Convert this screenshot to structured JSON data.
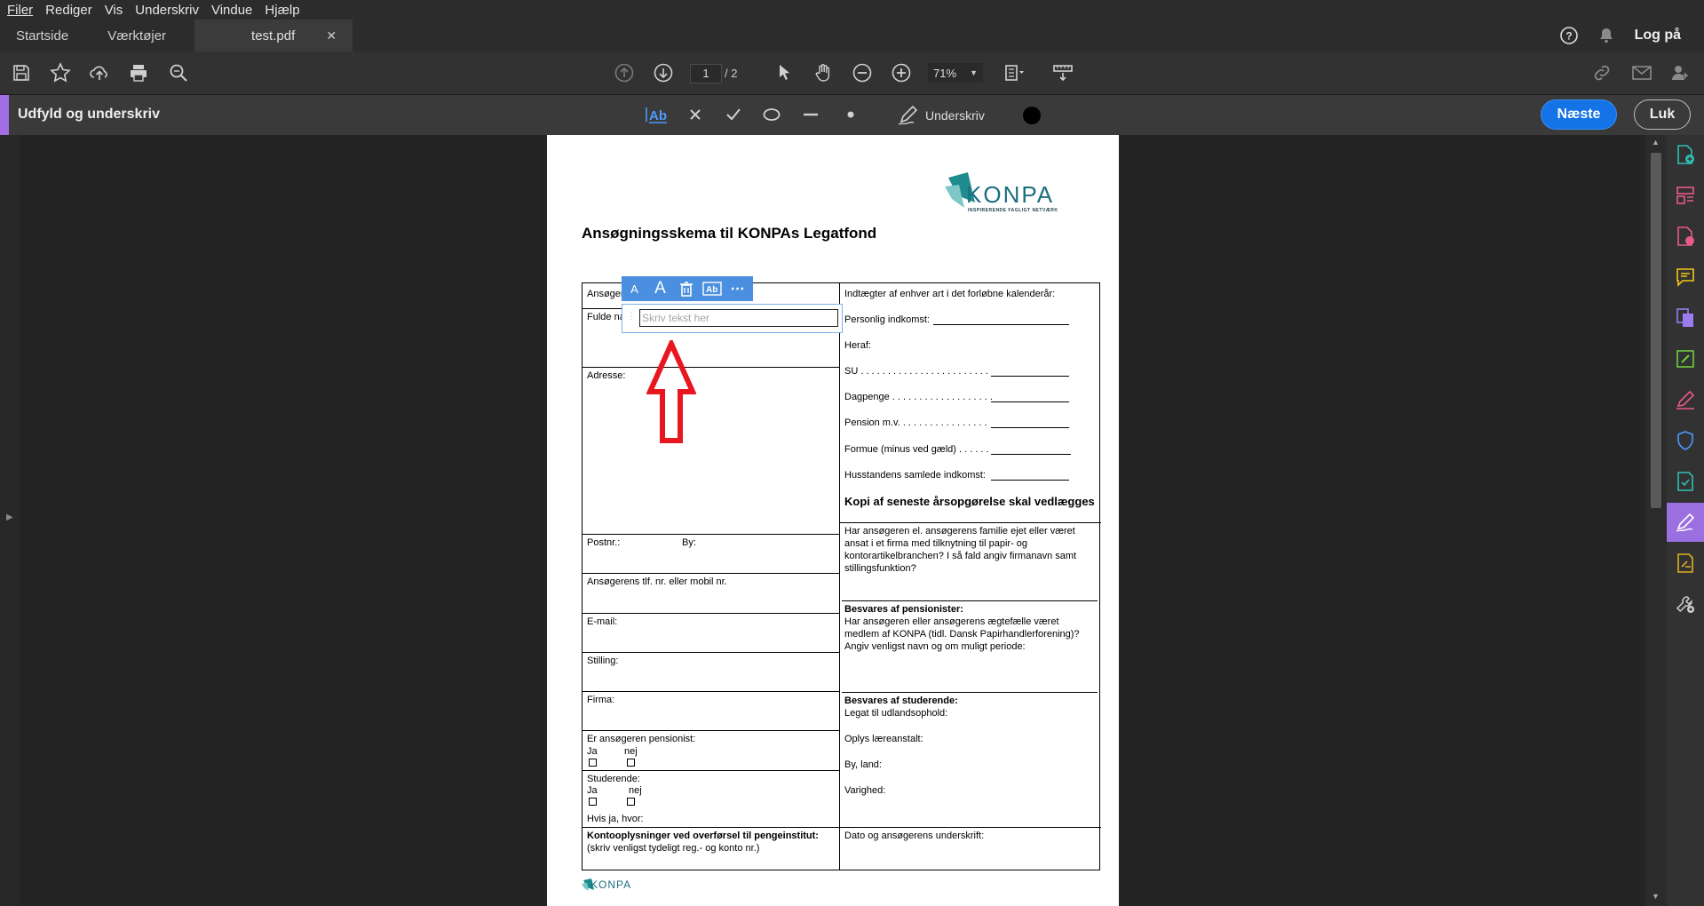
{
  "menu": [
    "Filer",
    "Rediger",
    "Vis",
    "Underskriv",
    "Vindue",
    "Hjælp"
  ],
  "tabs": {
    "home": "Startside",
    "tools": "Værktøjer",
    "document": "test.pdf"
  },
  "header": {
    "login": "Log på"
  },
  "toolbar": {
    "page_current": "1",
    "page_total": "/ 2",
    "zoom": "71%"
  },
  "fill_sign": {
    "title": "Udfyld og underskriv",
    "sign_label": "Underskriv",
    "next": "Næste",
    "close": "Luk",
    "ink_color": "#000000"
  },
  "textfield": {
    "placeholder": "Skriv tekst her"
  },
  "pdf": {
    "logo": "KONPA",
    "logo_tagline": "INSPIRERENDE FAGLIGT NETVÆRK",
    "heading": "Ansøgningsskema til KONPAs Legatfond",
    "left": {
      "applicant": "Ansøger",
      "fullname": "Fulde navn:",
      "address": "Adresse:",
      "postnr": "Postnr.:",
      "by": "By:",
      "phone": "Ansøgerens tlf. nr. eller mobil nr.",
      "email": "E-mail:",
      "position": "Stilling:",
      "company": "Firma:",
      "pensioner_q": "Er ansøgeren pensionist:",
      "yes": "Ja",
      "no": "nej",
      "student_q": "Studerende:",
      "if_yes": "Hvis ja, hvor:",
      "account_title": "Kontooplysninger ved overførsel til pengeinstitut:",
      "account_sub": "(skriv venligst tydeligt reg.- og konto nr.)"
    },
    "right": {
      "income_title": "Indtægter af enhver art i det forløbne kalenderår:",
      "personal_income": "Personlig indkomst:",
      "of_which": "Heraf:",
      "su": "SU . . . . . . . . . . . . . . . . . . . . . . . .",
      "dagpenge": "Dagpenge . . . . . . . . . . . . . . . . . . .",
      "pension": "Pension m.v.  . . . . . . . . . . . . . . . .",
      "formue": "Formue (minus ved gæld) . . . . . .",
      "household": "Husstandens samlede indkomst:",
      "copy_note": "Kopi af seneste årsopgørelse skal vedlægges",
      "family_q": "Har ansøgeren el. ansøgerens familie ejet eller været ansat i et firma med tilknytning til papir- og kontorartikelbranchen? I så fald angiv firmanavn samt stillingsfunktion?",
      "pensioners_title": "Besvares af pensionister:",
      "pensioners_text": "Har ansøgeren eller ansøgerens ægtefælle været medlem af KONPA (tidl. Dansk Papirhandlerforening)? Angiv venligst navn og om muligt periode:",
      "students_title": "Besvares af studerende:",
      "students_l1": "Legat til udlandsophold:",
      "students_l2": "Oplys læreanstalt:",
      "students_l3": "By, land:",
      "students_l4": "Varighed:",
      "signature": "Dato og ansøgerens underskrift:"
    },
    "footer_logo": "KONPA"
  }
}
